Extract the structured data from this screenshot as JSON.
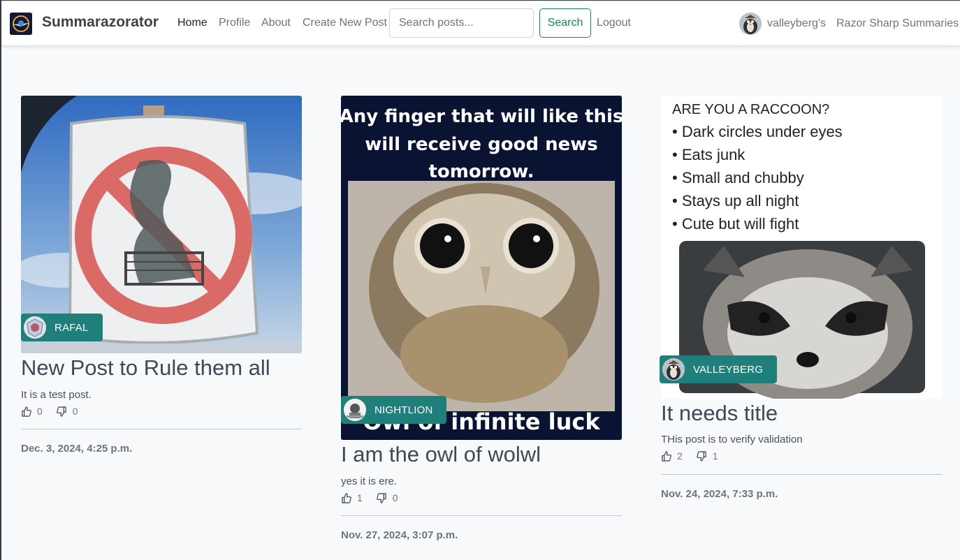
{
  "app": {
    "brand": "Summarazorator",
    "colors": {
      "accent": "#198754",
      "badge": "#1f7f7a",
      "background": "#f8f9fa"
    }
  },
  "nav": {
    "items": [
      {
        "label": "Home",
        "active": true
      },
      {
        "label": "Profile"
      },
      {
        "label": "About"
      },
      {
        "label": "Create New Post"
      }
    ],
    "search_placeholder": "Search posts...",
    "search_label": "Search",
    "logout_label": "Logout",
    "user_name": "valleyberg's",
    "tagline": "Razor Sharp Summaries"
  },
  "posts": [
    {
      "author": "RAFAL",
      "title": "New Post to Rule them all",
      "description": "It is a test post.",
      "likes": "0",
      "dislikes": "0",
      "date": "Dec. 3, 2024, 4:25 p.m."
    },
    {
      "author": "NIGHTLION",
      "title": "I am the owl of wolwl",
      "description": "yes it is ere.",
      "likes": "1",
      "dislikes": "0",
      "date": "Nov. 27, 2024, 3:07 p.m.",
      "image_text": {
        "line1": "Any finger that will like this",
        "line2": "will receive good news",
        "line3": "tomorrow.",
        "caption": "Owl of infinite luck"
      }
    },
    {
      "author": "VALLEYBERG",
      "title": "It needs title",
      "description": "THis post is to verify validation",
      "likes": "2",
      "dislikes": "1",
      "date": "Nov. 24, 2024, 7:33 p.m.",
      "image_text": {
        "heading": "ARE YOU A RACCOON?",
        "bullets": [
          "• Dark circles under eyes",
          "• Eats junk",
          "• Small and chubby",
          "• Stays up all night",
          "• Cute but will fight"
        ]
      }
    }
  ]
}
